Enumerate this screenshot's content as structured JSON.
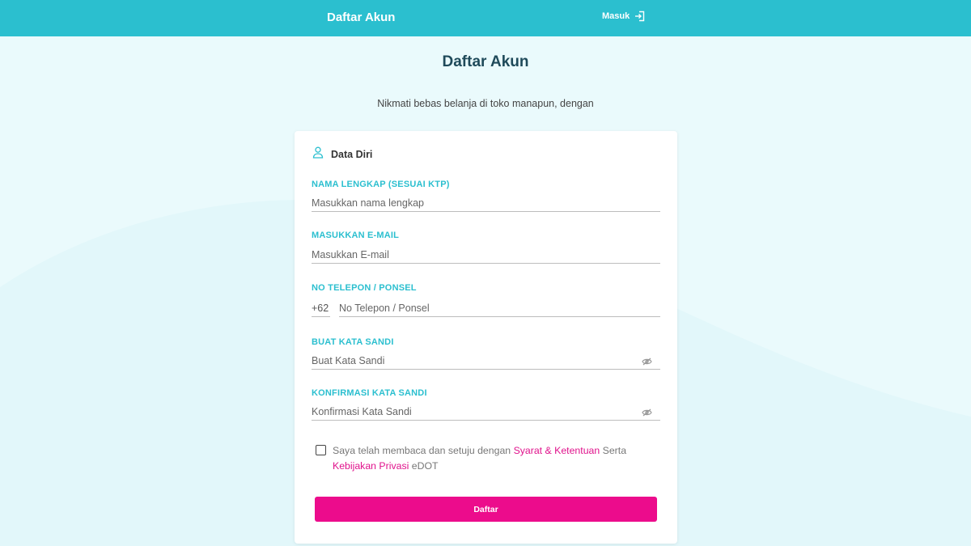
{
  "header": {
    "brand": "Daftar Akun",
    "login_label": "Masuk",
    "login_icon": "sign-in-icon",
    "bg_color": "#2bbfcf"
  },
  "page": {
    "title": "Daftar Akun",
    "subtitle": "Nikmati bebas belanja di toko manapun, dengan"
  },
  "form": {
    "section_title": "Data Diri",
    "section_icon": "user-icon",
    "fields": {
      "full_name": {
        "label": "NAMA LENGKAP (SESUAI KTP)",
        "placeholder": "Masukkan nama lengkap"
      },
      "email": {
        "label": "MASUKKAN E-MAIL",
        "placeholder": "Masukkan E-mail"
      },
      "phone": {
        "label": "NO TELEPON / PONSEL",
        "prefix": "+62",
        "placeholder": "No Telepon / Ponsel"
      },
      "password": {
        "label": "BUAT KATA SANDI",
        "placeholder": "Buat Kata Sandi",
        "toggle_icon": "eye-off-icon"
      },
      "confirm_password": {
        "label": "KONFIRMASI KATA SANDI",
        "placeholder": "Konfirmasi Kata Sandi",
        "toggle_icon": "eye-off-icon"
      }
    },
    "terms": {
      "checked": false,
      "text_before": "Saya telah membaca dan setuju dengan ",
      "link_terms": "Syarat & Ketentuan",
      "text_middle": " Serta ",
      "link_privacy": "Kebijakan Privasi",
      "text_after": " eDOT"
    },
    "submit_label": "Daftar"
  },
  "colors": {
    "accent": "#2bbfcf",
    "primary_button": "#ec0c8c",
    "link": "#e0138c",
    "background": "#eafafc"
  }
}
